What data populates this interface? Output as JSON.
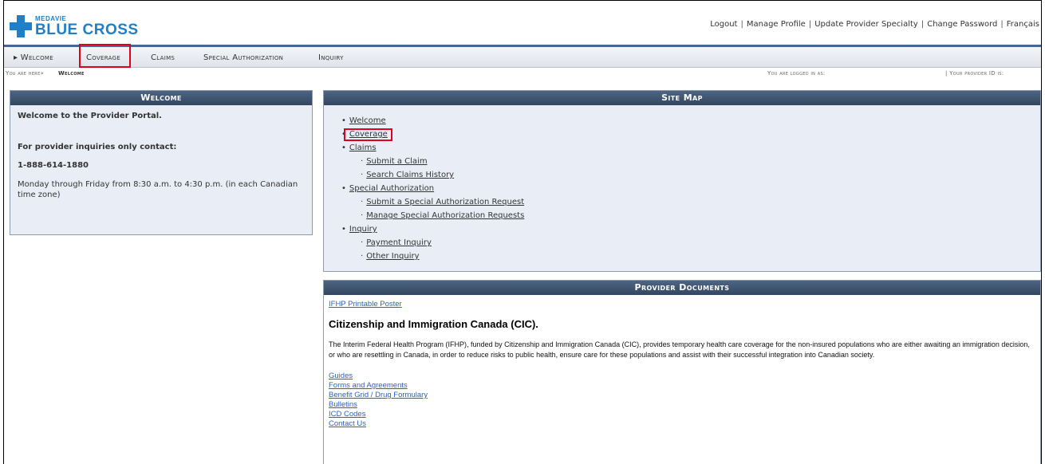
{
  "header": {
    "logo_top": "MEDAVIE",
    "logo_main": "BLUE CROSS",
    "links": [
      "Logout",
      "Manage Profile",
      "Update Provider Specialty",
      "Change Password",
      "Français"
    ]
  },
  "nav": {
    "items": [
      "▸ Welcome",
      "Coverage",
      "Claims",
      "Special Authorization",
      "Inquiry"
    ]
  },
  "breadcrumb": {
    "you_are_here": "You are here»",
    "current": "Welcome",
    "logged_in": "You are logged in as:",
    "provider_id": "| Your provider ID is:"
  },
  "welcome": {
    "title": "Welcome",
    "intro": "Welcome to the Provider Portal.",
    "contact_heading": "For provider inquiries only contact:",
    "phone": "1-888-614-1880",
    "hours": "Monday through Friday from 8:30 a.m. to 4:30 p.m. (in each Canadian time zone)"
  },
  "sitemap": {
    "title": "Site Map",
    "items": [
      {
        "label": "Welcome"
      },
      {
        "label": "Coverage"
      },
      {
        "label": "Claims"
      },
      {
        "label": "Submit a Claim"
      },
      {
        "label": "Search Claims History"
      },
      {
        "label": "Special Authorization"
      },
      {
        "label": "Submit a Special Authorization Request"
      },
      {
        "label": "Manage Special Authorization Requests"
      },
      {
        "label": "Inquiry"
      },
      {
        "label": "Payment Inquiry"
      },
      {
        "label": "Other Inquiry"
      }
    ]
  },
  "documents": {
    "title": "Provider Documents",
    "poster_link": "IFHP Printable Poster",
    "cic_title": "Citizenship and Immigration Canada (CIC).",
    "cic_text": "The Interim Federal Health Program (IFHP), funded by Citizenship and Immigration Canada (CIC), provides temporary health care coverage for the non-insured populations who are either awaiting an immigration decision, or who are resettling in Canada, in order to reduce risks to public health, ensure care for these populations and assist with their successful integration into Canadian society.",
    "links": [
      "Guides",
      "Forms and Agreements",
      "Benefit Grid / Drug Formulary",
      "Bulletins",
      "ICD Codes",
      "Contact Us"
    ]
  },
  "colors": {
    "brand_blue": "#1f7fc8",
    "header_bar": "#44679a",
    "panel_head": "#33465f",
    "panel_bg": "#e9eef6",
    "highlight_red": "#e0001b",
    "link_blue": "#2a62c5"
  }
}
